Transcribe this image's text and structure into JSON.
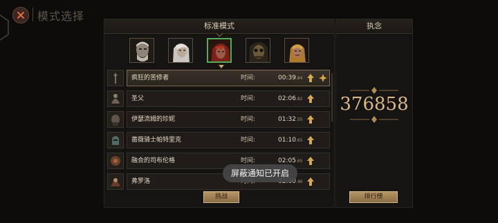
{
  "header": {
    "title": "模式选择"
  },
  "mode_panel": {
    "title": "标准模式"
  },
  "portraits": [
    {
      "name": "old-man",
      "selected": false
    },
    {
      "name": "white-haired-woman",
      "selected": false
    },
    {
      "name": "red-hooded-woman",
      "selected": true
    },
    {
      "name": "hooded-skull",
      "selected": false
    },
    {
      "name": "blonde-woman",
      "selected": false
    }
  ],
  "rows": [
    {
      "name": "疯狂的苦修者",
      "time_label": "时间:",
      "time": "00:39",
      "ms": ".84",
      "active": true,
      "star": true
    },
    {
      "name": "圣父",
      "time_label": "时间:",
      "time": "02:06",
      "ms": ".82",
      "active": false,
      "star": false
    },
    {
      "name": "伊瑟流姆的珍妮",
      "time_label": "时间:",
      "time": "01:32",
      "ms": ".55",
      "active": false,
      "star": false
    },
    {
      "name": "蔷薇骑士帕特里克",
      "time_label": "时间:",
      "time": "01:10",
      "ms": ".65",
      "active": false,
      "star": false
    },
    {
      "name": "融合的司布伦格",
      "time_label": "时间:",
      "time": "02:05",
      "ms": ".65",
      "active": false,
      "star": false
    },
    {
      "name": "弗罗洛",
      "time_label": "时间:",
      "time": "02:00",
      "ms": ".40",
      "active": false,
      "star": false
    }
  ],
  "buttons": {
    "challenge": "挑战",
    "ranking": "排行榜"
  },
  "side_panel": {
    "title": "执念",
    "score": "376858"
  },
  "toast": "屏蔽通知已开启",
  "colors": {
    "accent_gold": "#d9b98a",
    "selected_green": "#4fae57",
    "background": "#0d0c0b"
  }
}
